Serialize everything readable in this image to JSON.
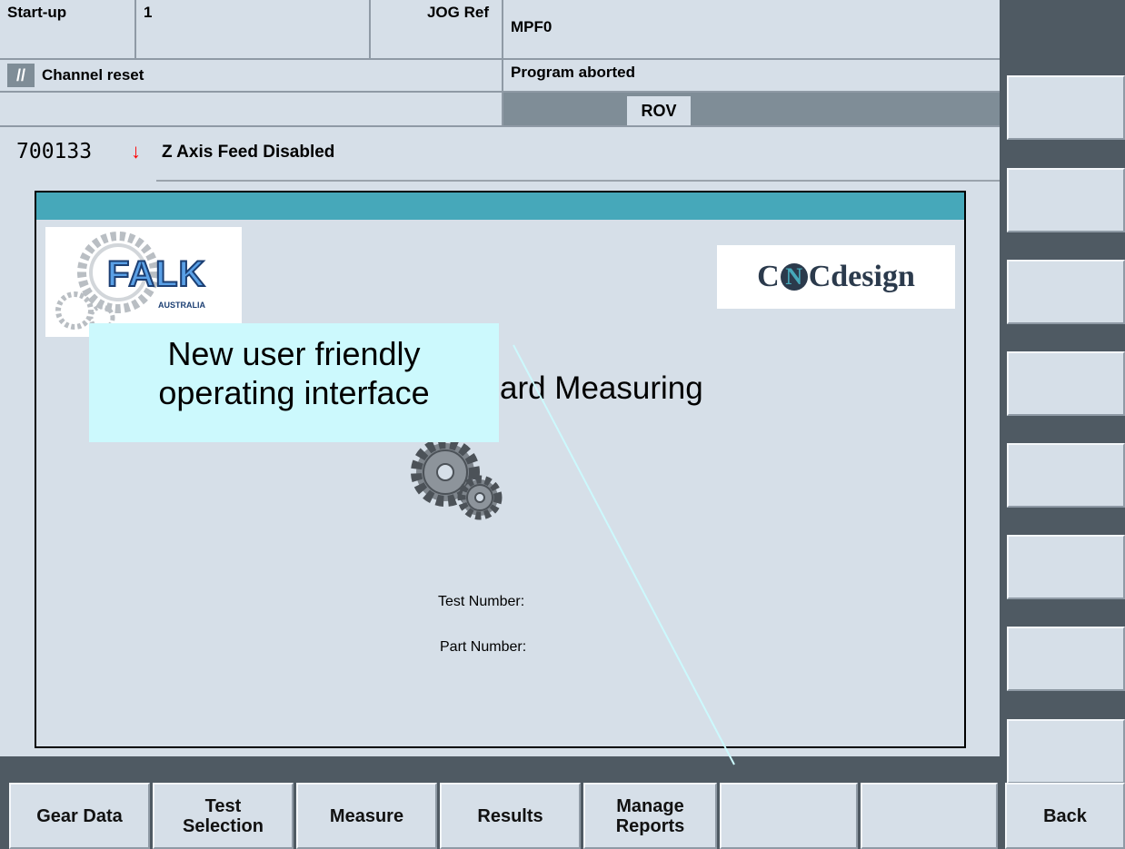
{
  "status": {
    "mode": "Start-up",
    "channel": "1",
    "op_mode": "JOG Ref",
    "program": "MPF0",
    "channel_state": "Channel reset",
    "program_state": "Program aborted",
    "rov": "ROV"
  },
  "alarm": {
    "number": "700133",
    "text": "Z Axis Feed Disabled",
    "icon": "red-down-arrow-icon"
  },
  "logos": {
    "falk_main": "FALK",
    "falk_sub": "AUSTRALIA",
    "cnc_a": "C",
    "cnc_n": "N",
    "cnc_c": "C",
    "cnc_design": "design"
  },
  "main": {
    "title_partial": "ard Measuring",
    "test_number_label": "Test Number:",
    "part_number_label": "Part Number:"
  },
  "callout": {
    "line1": "New user friendly",
    "line2": "operating interface"
  },
  "softkeys_bottom": [
    "Gear Data",
    "Test Selection",
    "Measure",
    "Results",
    "Manage Reports",
    "",
    "",
    "Back"
  ],
  "colors": {
    "accent_bar": "#46a8ba",
    "alarm_arrow": "#ff0000",
    "callout_bg": "#ccf9fd"
  }
}
